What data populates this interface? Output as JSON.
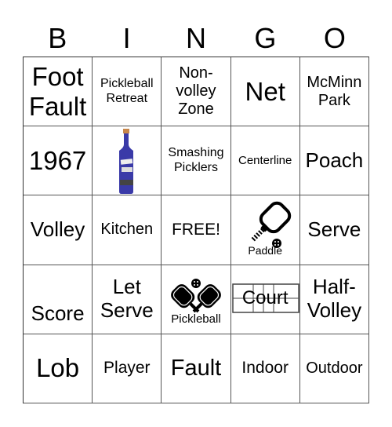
{
  "header": [
    "B",
    "I",
    "N",
    "G",
    "O"
  ],
  "cells": [
    {
      "text": "Foot Fault",
      "lines": [
        "Foot",
        "Fault"
      ],
      "size": "s34"
    },
    {
      "text": "Pickleball Retreat",
      "lines": [
        "Pickleball",
        "Retreat"
      ],
      "size": "s16"
    },
    {
      "text": "Non-volley Zone",
      "lines": [
        "Non-",
        "volley",
        "Zone"
      ],
      "size": "s20"
    },
    {
      "text": "Net",
      "lines": [
        "Net"
      ],
      "size": "s34"
    },
    {
      "text": "McMinn Park",
      "lines": [
        "McMinn",
        "Park"
      ],
      "size": "s20"
    },
    {
      "text": "1967",
      "lines": [
        "1967"
      ],
      "size": "s34"
    },
    {
      "text": "",
      "image": "gin-bottle",
      "bottle_color": "#3a3aa8"
    },
    {
      "text": "Smashing Picklers",
      "lines": [
        "Smashing",
        "Picklers"
      ],
      "size": "s16"
    },
    {
      "text": "Centerline",
      "lines": [
        "Centerline"
      ],
      "size": "s15"
    },
    {
      "text": "Poach",
      "lines": [
        "Poach"
      ],
      "size": "s26"
    },
    {
      "text": "Volley",
      "lines": [
        "Volley"
      ],
      "size": "s26"
    },
    {
      "text": "Kitchen",
      "lines": [
        "Kitchen"
      ],
      "size": "s20"
    },
    {
      "text": "FREE!",
      "lines": [
        "FREE!"
      ],
      "size": "s22"
    },
    {
      "text": "Paddle",
      "image": "paddle",
      "lines": [
        "Paddle"
      ]
    },
    {
      "text": "Serve",
      "lines": [
        "Serve"
      ],
      "size": "s26"
    },
    {
      "text": "Score",
      "lines": [
        "Score"
      ],
      "size": "s26"
    },
    {
      "text": "Let Serve",
      "lines": [
        "Let",
        "Serve"
      ],
      "size": "s26"
    },
    {
      "text": "Pickleball",
      "image": "crossed-paddles",
      "lines": [
        "Pickleball"
      ]
    },
    {
      "text": "Court",
      "image": "court",
      "lines": [
        "Court"
      ]
    },
    {
      "text": "Half-Volley",
      "lines": [
        "Half-",
        "Volley"
      ],
      "size": "s26"
    },
    {
      "text": "Lob",
      "lines": [
        "Lob"
      ],
      "size": "s34"
    },
    {
      "text": "Player",
      "lines": [
        "Player"
      ],
      "size": "s22"
    },
    {
      "text": "Fault",
      "lines": [
        "Fault"
      ],
      "size": "s30"
    },
    {
      "text": "Indoor",
      "lines": [
        "Indoor"
      ],
      "size": "s22"
    },
    {
      "text": "Outdoor",
      "lines": [
        "Outdoor"
      ],
      "size": "s20"
    }
  ]
}
